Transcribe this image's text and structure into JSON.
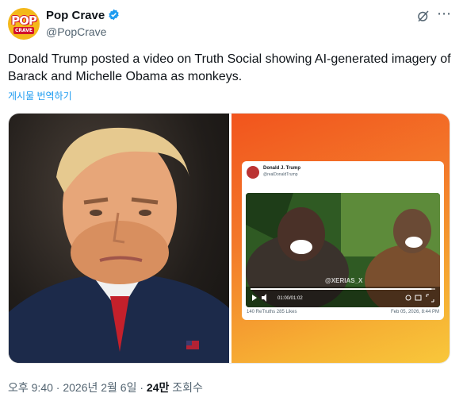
{
  "account": {
    "name": "Pop Crave",
    "handle": "@PopCrave",
    "avatar_text_top": "POP",
    "avatar_text_bottom": "CRAVE"
  },
  "icons": {
    "verified": "verified-badge-icon",
    "grok": "grok-icon",
    "more": "more-icon"
  },
  "tweet": {
    "text": "Donald Trump posted a video on Truth Social showing AI-generated imagery of Barack and Michelle Obama as monkeys.",
    "translate_link": "게시물 번역하기"
  },
  "embedded_post": {
    "name": "Donald J. Trump",
    "handle": "@realDonaldTrump",
    "watermark": "@XERIAS_X",
    "video_time": "01:00/01:02",
    "video_progress": 0.98,
    "stats": "140 ReTruths  285 Likes",
    "date": "Feb 05, 2026, 8:44 PM"
  },
  "footer": {
    "time_date": "오후 9:40 · 2026년 2월 6일 · ",
    "views_count": "24만",
    "views_label": " 조회수"
  },
  "colors": {
    "accent": "#1d9bf0",
    "verified": "#1d9bf0",
    "secondary_text": "#536471"
  }
}
